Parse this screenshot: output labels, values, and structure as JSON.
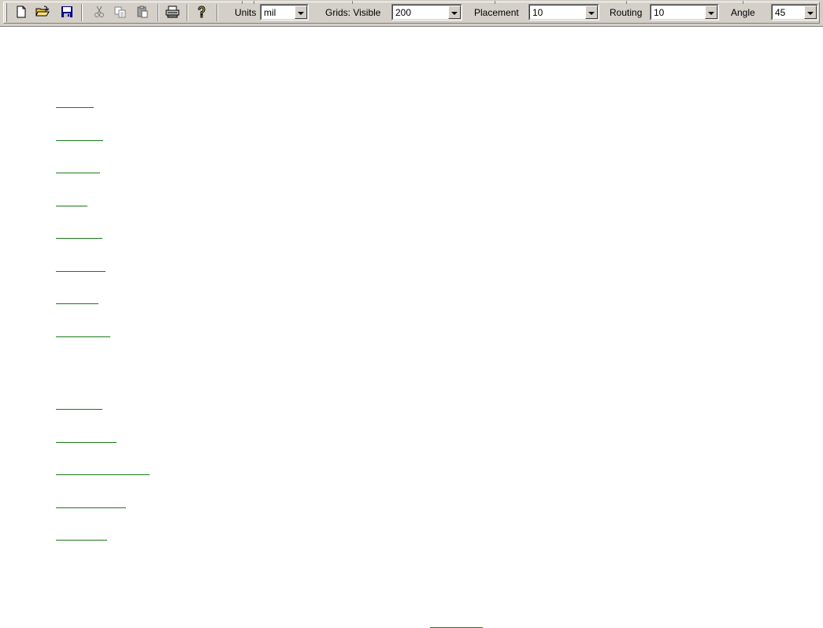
{
  "toolbar": {
    "buttons": [
      {
        "name": "new-file-icon"
      },
      {
        "name": "open-folder-icon"
      },
      {
        "name": "save-icon"
      },
      {
        "name": "cut-icon"
      },
      {
        "name": "copy-icon"
      },
      {
        "name": "paste-icon"
      },
      {
        "name": "print-icon"
      },
      {
        "name": "help-icon"
      }
    ],
    "units_label": "Units",
    "units_value": "mil",
    "grids_label": "Grids: Visible",
    "grids_value": "200",
    "placement_label": "Placement",
    "placement_value": "10",
    "routing_label": "Routing",
    "routing_value": "10",
    "angle_label": "Angle",
    "angle_value": "45"
  },
  "colors": {
    "toolbar_bg": "#d4d0c8",
    "link_underline": "#1a7a1a"
  }
}
